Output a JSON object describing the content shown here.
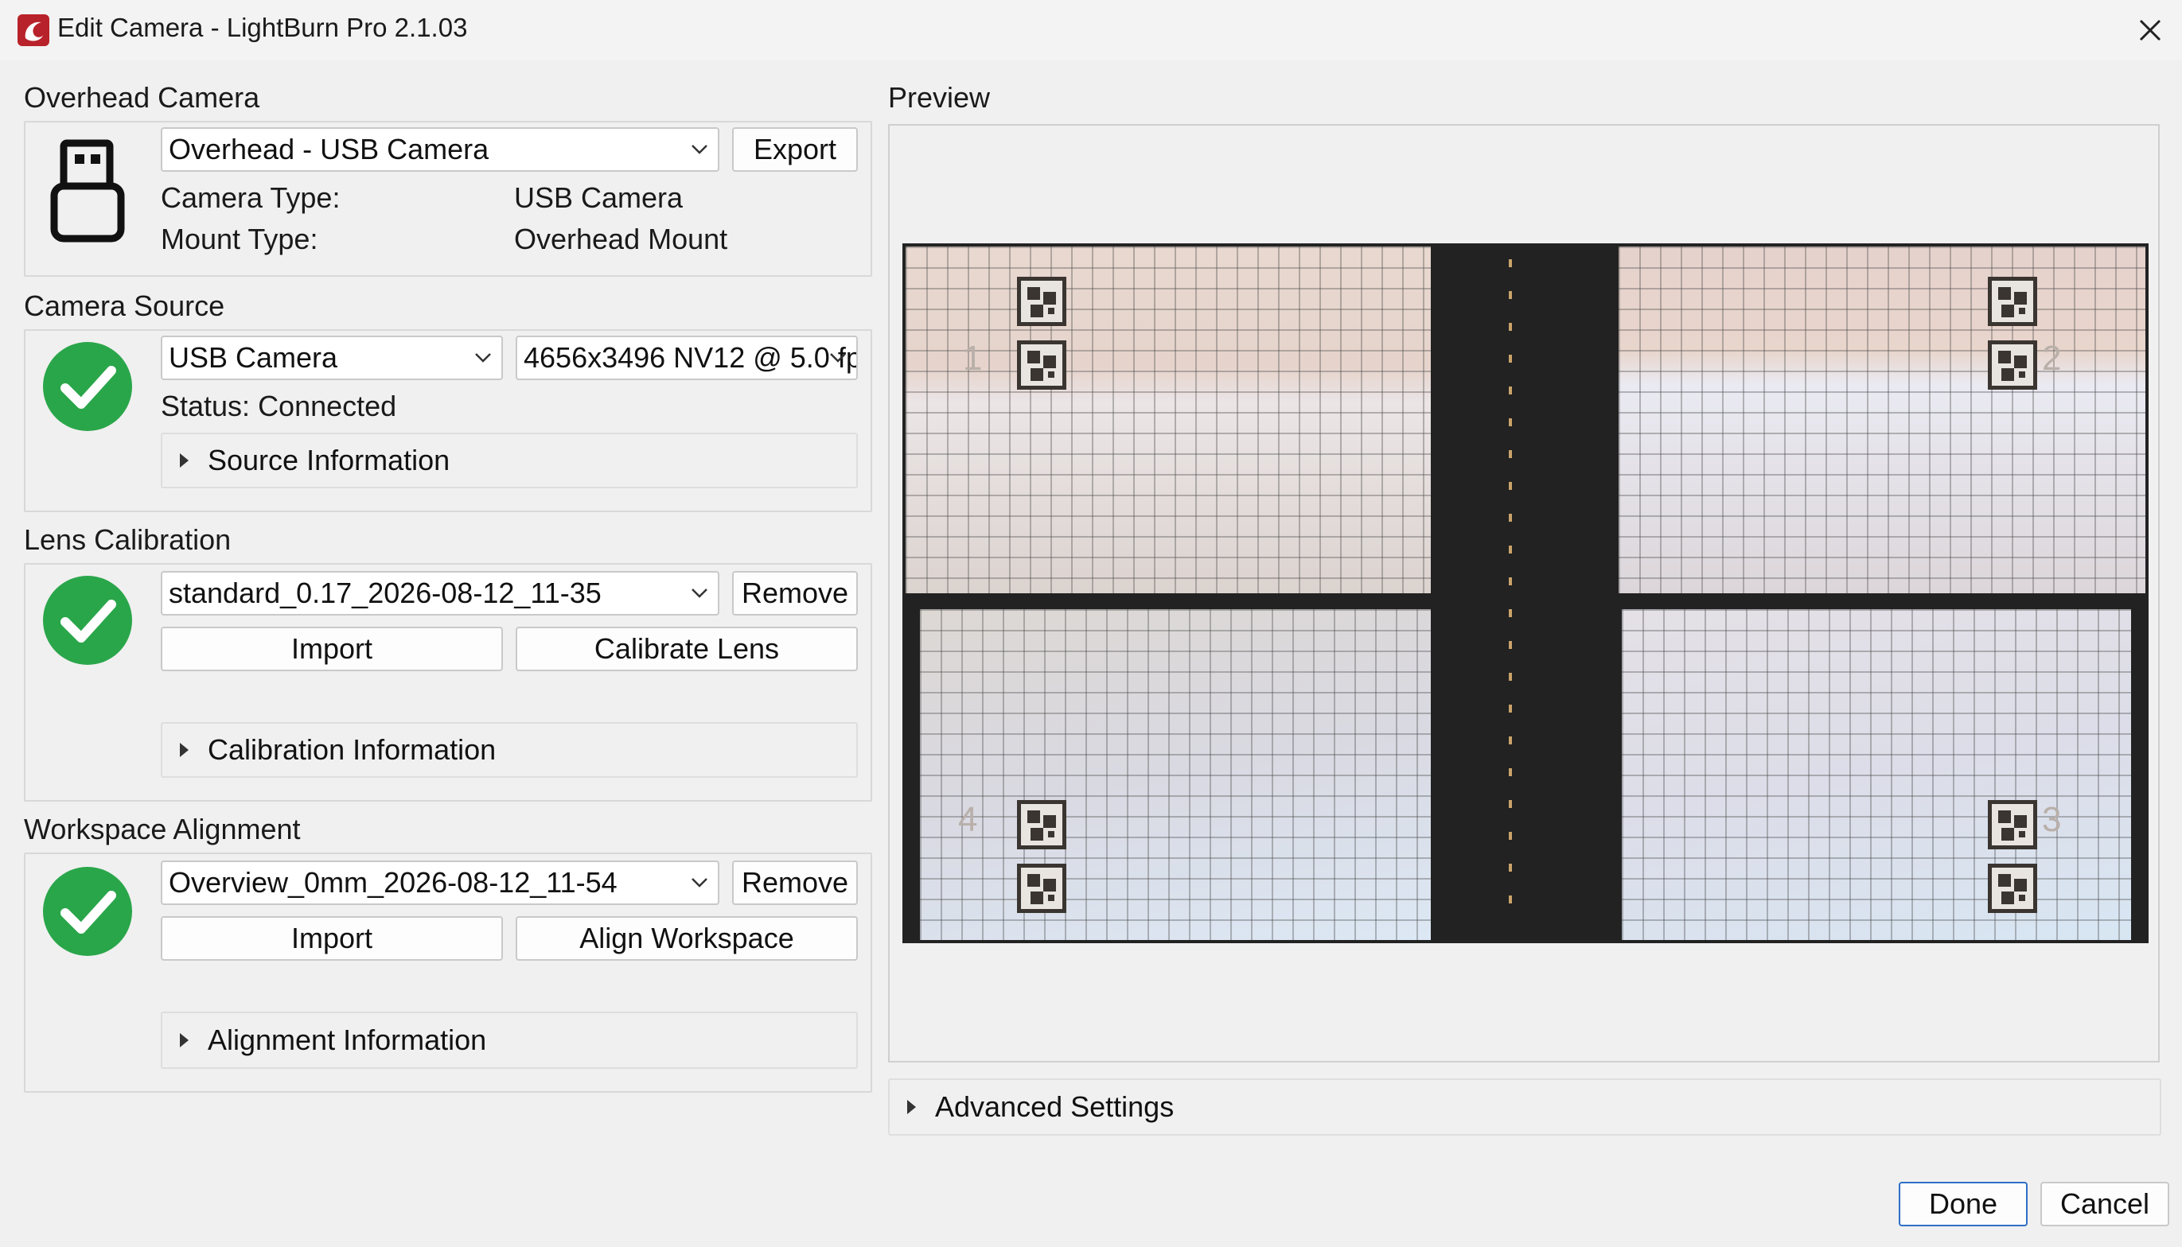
{
  "window": {
    "title": "Edit Camera - LightBurn Pro 2.1.03"
  },
  "overhead_camera": {
    "section_label": "Overhead Camera",
    "camera_select": "Overhead - USB Camera",
    "export_label": "Export",
    "camera_type_label": "Camera Type:",
    "camera_type_value": "USB Camera",
    "mount_type_label": "Mount Type:",
    "mount_type_value": "Overhead Mount",
    "icon": "usb-icon"
  },
  "camera_source": {
    "section_label": "Camera Source",
    "source_select": "USB Camera",
    "resolution_select": "4656x3496 NV12 @ 5.0 fp",
    "status": "Status: Connected",
    "info_expander": "Source Information",
    "icon": "check-circle-icon"
  },
  "lens_calibration": {
    "section_label": "Lens Calibration",
    "calibration_select": "standard_0.17_2026-08-12_11-35",
    "remove_label": "Remove",
    "import_label": "Import",
    "calibrate_label": "Calibrate Lens",
    "info_expander": "Calibration Information",
    "icon": "check-circle-icon"
  },
  "workspace_alignment": {
    "section_label": "Workspace Alignment",
    "alignment_select": "Overview_0mm_2026-08-12_11-54",
    "remove_label": "Remove",
    "import_label": "Import",
    "align_label": "Align Workspace",
    "info_expander": "Alignment Information",
    "icon": "check-circle-icon"
  },
  "preview": {
    "section_label": "Preview",
    "marker_numbers": [
      "1",
      "2",
      "3",
      "4"
    ]
  },
  "advanced": {
    "expander_label": "Advanced Settings"
  },
  "footer": {
    "done_label": "Done",
    "cancel_label": "Cancel"
  },
  "colors": {
    "accent_green": "#2aa64a",
    "done_border": "#2f6fc6",
    "background": "#f0f0f0"
  }
}
